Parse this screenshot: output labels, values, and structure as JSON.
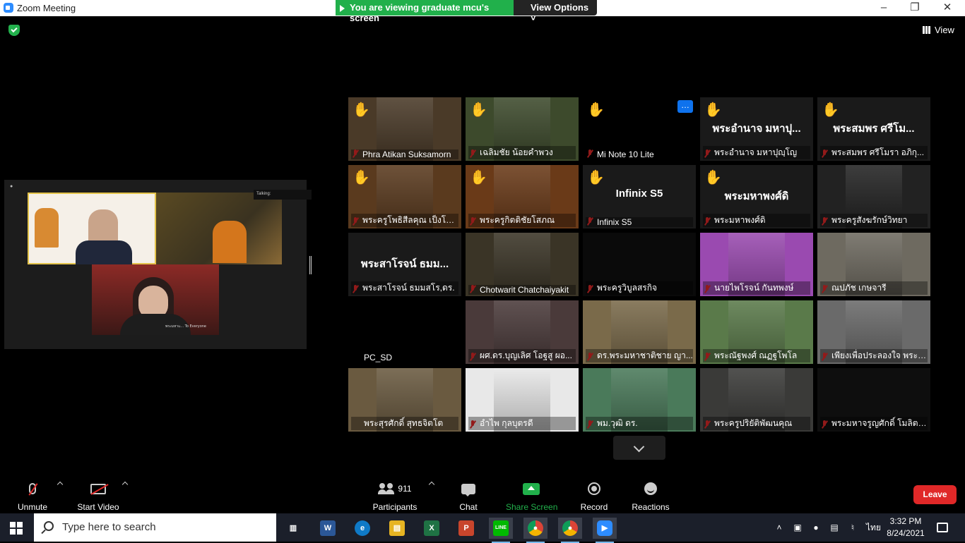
{
  "window": {
    "title": "Zoom Meeting"
  },
  "share_banner": {
    "text": "You are viewing graduate mcu's screen",
    "view_options": "View Options"
  },
  "view_button": {
    "label": "View"
  },
  "shared_screen": {
    "status_label": "Talking:",
    "chat_caption": "พระมหาแ... To Everyone"
  },
  "gallery": {
    "tiles": [
      {
        "name": "Phra Atikan Suksamorn",
        "muted": true,
        "hand": true,
        "big": "",
        "bg": "#4a3a28"
      },
      {
        "name": "เฉลิมชัย น้อยคำพวง",
        "muted": true,
        "hand": true,
        "big": "",
        "bg": "#3d4a2c"
      },
      {
        "name": "Mi Note 10 Lite",
        "muted": true,
        "hand": true,
        "big": "",
        "bg": "#000000",
        "more": true
      },
      {
        "name": "พระอำนาจ มหาปุญฺโญ",
        "muted": true,
        "hand": true,
        "big": "พระอำนาจ มหาปุ...",
        "bg": "#1a1a1a"
      },
      {
        "name": "พระสมพร ศรีโมรา อภิกุ...",
        "muted": true,
        "hand": true,
        "big": "พระสมพร ศรีโม...",
        "bg": "#1a1a1a"
      },
      {
        "name": "พระครูโพธิสีลคุณ เป็งโยยโม",
        "muted": true,
        "hand": true,
        "big": "",
        "bg": "#5a3a1e"
      },
      {
        "name": "พระครูกิตติชัยโสภณ",
        "muted": true,
        "hand": true,
        "big": "",
        "bg": "#6a3a18"
      },
      {
        "name": "Infinix S5",
        "muted": true,
        "hand": true,
        "big": "Infinix S5",
        "bg": "#1a1a1a"
      },
      {
        "name": "พระมหาพงศ์ดิ",
        "muted": true,
        "hand": true,
        "big": "พระมหาพงศ์ดิ",
        "bg": "#1a1a1a"
      },
      {
        "name": "พระครูสังฆรักษ์วิทยา",
        "muted": true,
        "hand": false,
        "big": "",
        "bg": "#222222"
      },
      {
        "name": "พระสาโรจน์ ธมมสโร,ดร.",
        "muted": true,
        "hand": false,
        "big": "พระสาโรจน์ ธมม...",
        "bg": "#1a1a1a"
      },
      {
        "name": "Chotwarit Chatchaiyakit",
        "muted": true,
        "hand": false,
        "big": "",
        "bg": "#3a3426"
      },
      {
        "name": "พระครูวิบูลสรกิจ",
        "muted": true,
        "hand": false,
        "big": "",
        "bg": "#0a0a0a"
      },
      {
        "name": "นายไพโรจน์ กันทพงษ์",
        "muted": true,
        "hand": false,
        "big": "",
        "bg": "#9a4ab0"
      },
      {
        "name": "ณปภัช เกษจารี",
        "muted": true,
        "hand": false,
        "big": "",
        "bg": "#6e6a60"
      },
      {
        "name": "PC_SD",
        "muted": false,
        "hand": false,
        "big": "",
        "bg": "#000000"
      },
      {
        "name": "ผศ.ดร.บุญเลิศ โอฐสู ผอ...",
        "muted": true,
        "hand": false,
        "big": "",
        "bg": "#4a3a3a"
      },
      {
        "name": "ดร.พระมหาชาติชาย ญา...",
        "muted": true,
        "hand": false,
        "big": "",
        "bg": "#7a6a4a"
      },
      {
        "name": "พระณัฐพงศ์ ณฏฐโพโล",
        "muted": true,
        "hand": false,
        "big": "",
        "bg": "#5a7a4a"
      },
      {
        "name": "เพียงเพื่อประลองใจ พระอา...",
        "muted": true,
        "hand": false,
        "big": "",
        "bg": "#6a6a6a"
      },
      {
        "name": "พระสุรศักดิ์ สุทธจิตโต",
        "muted": false,
        "hand": false,
        "big": "",
        "bg": "#6a5a40"
      },
      {
        "name": "อำไพ กุลบุตรดี",
        "muted": true,
        "hand": false,
        "big": "",
        "bg": "#e8e8e8"
      },
      {
        "name": "พม.วุฒิ ดร.",
        "muted": true,
        "hand": false,
        "big": "",
        "bg": "#4a7a5a"
      },
      {
        "name": "พระครูปริยัติพัฒนคุณ",
        "muted": true,
        "hand": false,
        "big": "",
        "bg": "#3a3a38"
      },
      {
        "name": "พระมหาจรูญศักดิ์ โมลิตภ...",
        "muted": true,
        "hand": false,
        "big": "",
        "bg": "#0e0e0e"
      }
    ]
  },
  "toolbar": {
    "unmute": "Unmute",
    "start_video": "Start Video",
    "participants_count": "911",
    "participants": "Participants",
    "chat": "Chat",
    "share_screen": "Share Screen",
    "record": "Record",
    "reactions": "Reactions",
    "leave": "Leave"
  },
  "taskbar": {
    "search_placeholder": "Type here to search",
    "language": "ไทย",
    "time": "3:32 PM",
    "date": "8/24/2021",
    "apps": [
      "task-view",
      "word",
      "edge",
      "file-explorer",
      "excel",
      "powerpoint",
      "line",
      "chrome",
      "chrome",
      "zoom"
    ]
  },
  "colors": {
    "accent_green": "#21b04b",
    "leave_red": "#e02828",
    "muted_red": "#e02828",
    "hand_yellow": "#f2c230"
  }
}
